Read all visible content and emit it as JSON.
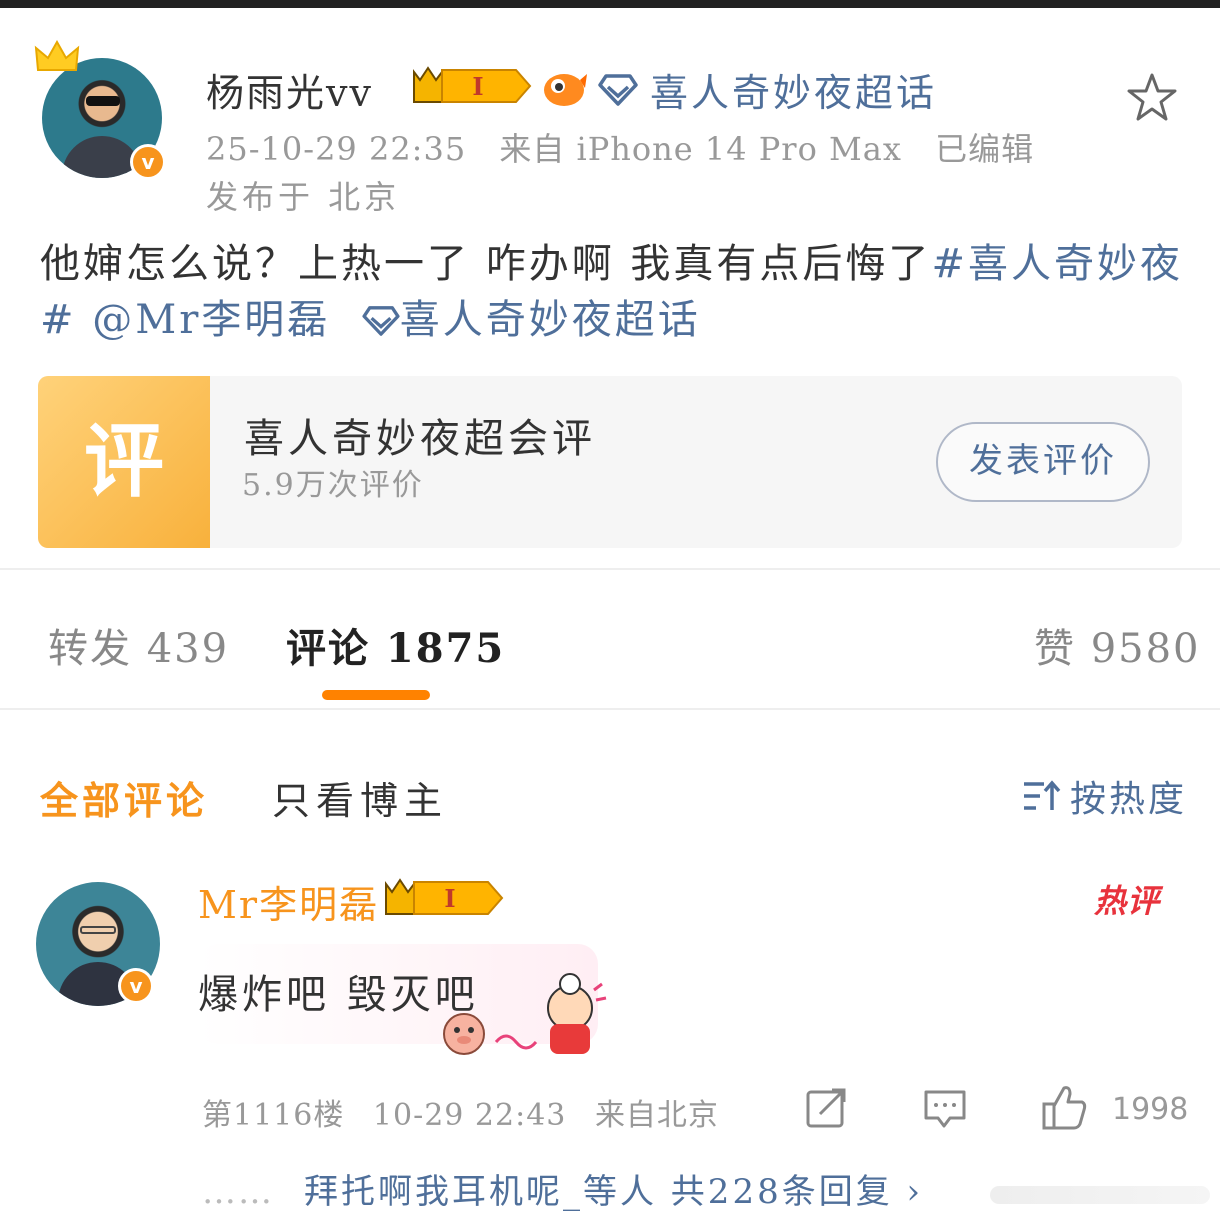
{
  "post": {
    "author": "杨雨光vv",
    "level": "I",
    "supertopic": "喜人奇妙夜超话",
    "date": "25-10-29 22:35",
    "source": "来自 iPhone 14 Pro Max",
    "edited": "已编辑",
    "location": "发布于 北京",
    "text_plain": "他婶怎么说？上热一了 咋办啊 我真有点后悔了",
    "hashtag": "#喜人奇妙夜#",
    "mention": "@Mr李明磊",
    "supertopic_link": "喜人奇妙夜超话"
  },
  "card": {
    "title": "喜人奇妙夜超会评",
    "subtitle": "5.9万次评价",
    "button": "发表评价",
    "thumb_glyph": "评"
  },
  "tabs": {
    "repost": "转发 439",
    "comments": "评论 1875",
    "likes": "赞 9580"
  },
  "filters": {
    "all": "全部评论",
    "blogger_only": "只看博主",
    "sort": "按热度"
  },
  "comment": {
    "author": "Mr李明磊",
    "level": "I",
    "hot_badge": "热评",
    "text": "爆炸吧 毁灭吧",
    "floor": "第1116楼",
    "time": "10-29 22:43",
    "location": "来自北京",
    "like_count": "1998",
    "replies_dots": "……",
    "replies_text": "拜托啊我耳机呢_等人 共228条回复 ›"
  },
  "colors": {
    "accent_orange": "#f7941d",
    "link_blue": "#4f6f9a",
    "hot_red": "#e8323c"
  },
  "icons": [
    "crown-icon",
    "verified-icon",
    "fish-icon",
    "diamond-icon",
    "star-icon",
    "sort-icon",
    "share-icon",
    "comment-icon",
    "like-icon"
  ]
}
